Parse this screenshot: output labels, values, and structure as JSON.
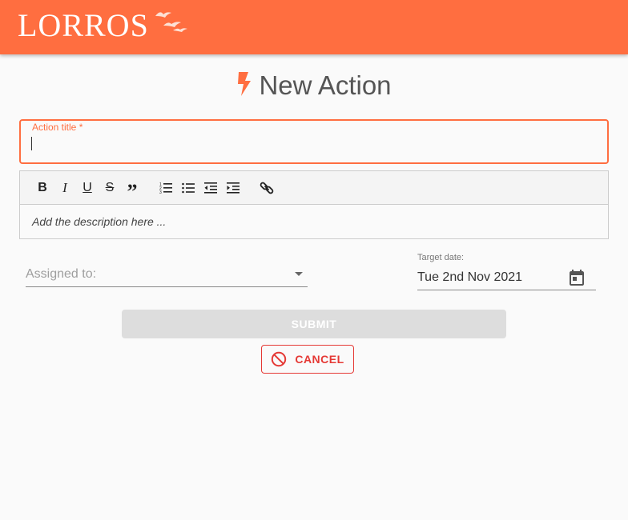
{
  "header": {
    "logo_text": "LORROS",
    "logo_icon": "birds-icon",
    "color": "#ff6e40"
  },
  "page": {
    "title": "New Action",
    "title_icon": "bolt-icon"
  },
  "form": {
    "action_title": {
      "label": "Action title *",
      "value": ""
    },
    "editor": {
      "toolbar": [
        "bold",
        "italic",
        "underline",
        "strikethrough",
        "blockquote",
        "ordered-list",
        "bulleted-list",
        "outdent",
        "indent",
        "link"
      ],
      "placeholder": "Add the description here ..."
    },
    "assigned_to": {
      "label": "Assigned to:",
      "value": ""
    },
    "target_date": {
      "label": "Target date:",
      "value": "Tue 2nd Nov 2021"
    },
    "submit_label": "SUBMIT",
    "cancel_label": "CANCEL"
  },
  "colors": {
    "accent": "#ff6e40",
    "cancel": "#e53935",
    "submit_disabled": "#dddddd"
  }
}
